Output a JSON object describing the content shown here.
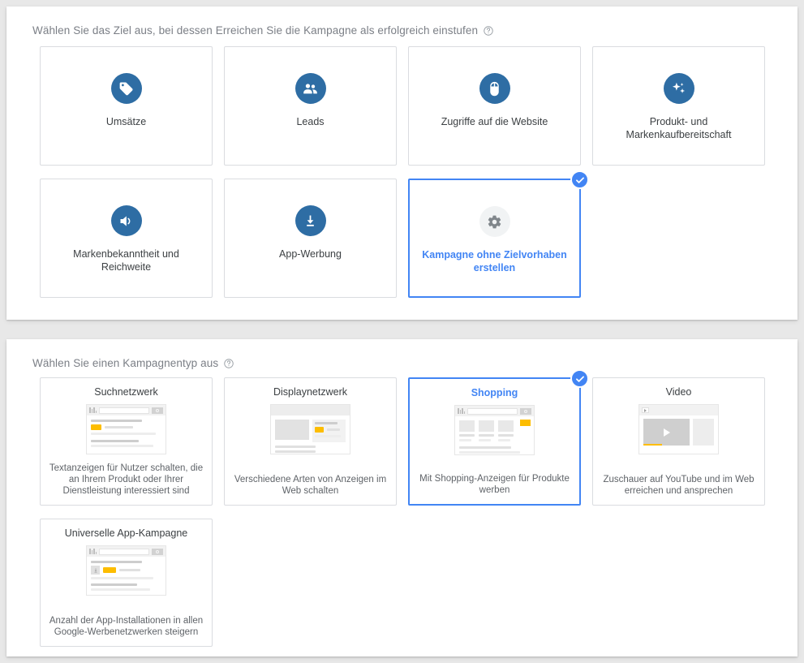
{
  "goals_section": {
    "title": "Wählen Sie das Ziel aus, bei dessen Erreichen Sie die Kampagne als erfolgreich einstufen",
    "help_icon": "help-circle-icon",
    "cards": [
      {
        "label": "Umsätze",
        "icon": "price-tag-icon",
        "selected": false
      },
      {
        "label": "Leads",
        "icon": "people-group-icon",
        "selected": false
      },
      {
        "label": "Zugriffe auf die Website",
        "icon": "computer-mouse-icon",
        "selected": false
      },
      {
        "label": "Produkt- und Markenkaufbereitschaft",
        "icon": "sparkle-icon",
        "selected": false
      },
      {
        "label": "Markenbekanntheit und Reichweite",
        "icon": "speaker-volume-icon",
        "selected": false
      },
      {
        "label": "App-Werbung",
        "icon": "download-icon",
        "selected": false
      },
      {
        "label": "Kampagne ohne Zielvorhaben erstellen",
        "icon": "gear-icon",
        "selected": true
      }
    ]
  },
  "types_section": {
    "title": "Wählen Sie einen Kampagnentyp aus",
    "help_icon": "help-circle-icon",
    "cards": [
      {
        "title": "Suchnetzwerk",
        "description": "Textanzeigen für Nutzer schalten, die an Ihrem Produkt oder Ihrer Dienstleistung interessiert sind",
        "illustration": "search-results-illustration",
        "selected": false
      },
      {
        "title": "Displaynetzwerk",
        "description": "Verschiedene Arten von Anzeigen im Web schalten",
        "illustration": "display-banner-illustration",
        "selected": false
      },
      {
        "title": "Shopping",
        "description": "Mit Shopping-Anzeigen für Produkte werben",
        "illustration": "shopping-products-illustration",
        "selected": true
      },
      {
        "title": "Video",
        "description": "Zuschauer auf YouTube und im Web erreichen und ansprechen",
        "illustration": "video-player-illustration",
        "selected": false
      },
      {
        "title": "Universelle App-Kampagne",
        "description": "Anzahl der App-Installationen in allen Google-Werbenetzwerken steigern",
        "illustration": "app-install-illustration",
        "selected": false
      }
    ]
  },
  "colors": {
    "accent_blue": "#4285f4",
    "icon_blue": "#2e6da4",
    "ad_yellow": "#fdbd00",
    "page_background": "#e8e8e8",
    "border_gray": "#dadce0"
  }
}
